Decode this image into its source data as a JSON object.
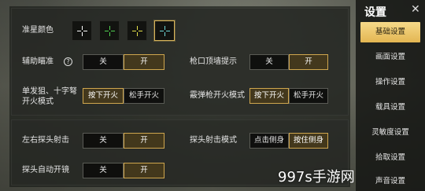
{
  "settings": {
    "crosshair_color_label": "准星颜色",
    "crosshair_swatches": [
      {
        "name": "white",
        "color": "#ffffff",
        "selected": false
      },
      {
        "name": "green",
        "color": "#4fd04f",
        "selected": false
      },
      {
        "name": "yellow",
        "color": "#e6e24a",
        "selected": false
      },
      {
        "name": "cyan",
        "color": "#6fd8d8",
        "selected": true
      }
    ],
    "aim_assist": {
      "label": "辅助瞄准",
      "help": "?",
      "off": "关",
      "on": "开",
      "value": "on"
    },
    "muzzle_hint": {
      "label": "枪口顶墙提示",
      "off": "关",
      "on": "开",
      "value": "on"
    },
    "single_fire_mode": {
      "label_line1": "单发狙、十字弩",
      "label_line2": "开火模式",
      "opt1": "按下开火",
      "opt2": "松手开火",
      "value": "opt1"
    },
    "shotgun_fire_mode": {
      "label": "霰弹枪开火模式",
      "opt1": "按下开火",
      "opt2": "松手开火",
      "value": "opt1"
    },
    "peek_fire": {
      "label": "左右探头射击",
      "off": "关",
      "on": "开",
      "value": "on"
    },
    "peek_fire_mode": {
      "label": "探头射击模式",
      "opt1": "点击侧身",
      "opt2": "按住侧身",
      "value": "opt2"
    },
    "peek_auto_scope": {
      "label": "探头自动开镜",
      "off": "关",
      "on": "开",
      "value": "on"
    }
  },
  "sidebar": {
    "title": "设置",
    "close": "✕",
    "items": [
      {
        "label": "基础设置",
        "active": true
      },
      {
        "label": "画面设置",
        "active": false
      },
      {
        "label": "操作设置",
        "active": false
      },
      {
        "label": "载具设置",
        "active": false
      },
      {
        "label": "灵敏度设置",
        "active": false
      },
      {
        "label": "拾取设置",
        "active": false
      },
      {
        "label": "声音设置",
        "active": false
      }
    ]
  },
  "watermark": "997s手游网",
  "accent_color": "#cfa64e"
}
